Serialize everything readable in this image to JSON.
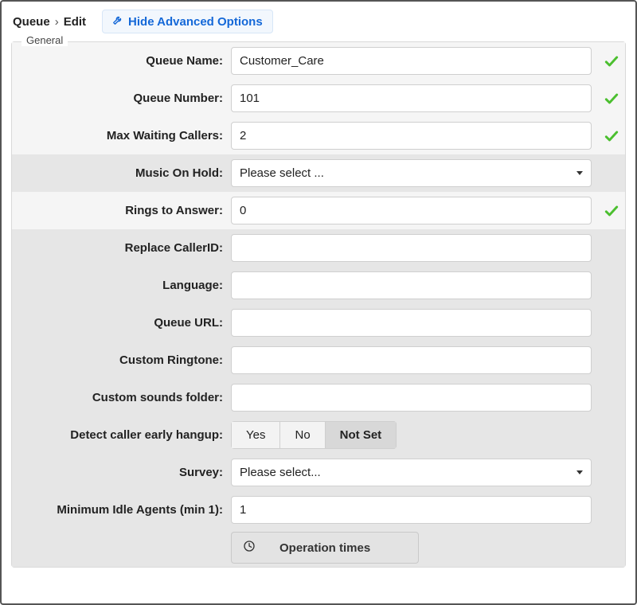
{
  "breadcrumb": {
    "item1": "Queue",
    "item2": "Edit"
  },
  "toggle": {
    "hide_advanced": "Hide Advanced Options"
  },
  "fieldset": {
    "title": "General"
  },
  "labels": {
    "queue_name": "Queue Name:",
    "queue_number": "Queue Number:",
    "max_waiting": "Max Waiting Callers:",
    "music_on_hold": "Music On Hold:",
    "rings_to_answer": "Rings to Answer:",
    "replace_callerid": "Replace CallerID:",
    "language": "Language:",
    "queue_url": "Queue URL:",
    "custom_ringtone": "Custom Ringtone:",
    "custom_sounds_folder": "Custom sounds folder:",
    "detect_hangup": "Detect caller early hangup:",
    "survey": "Survey:",
    "min_idle_agents": "Minimum Idle Agents (min 1):"
  },
  "values": {
    "queue_name": "Customer_Care",
    "queue_number": "101",
    "max_waiting": "2",
    "music_on_hold": "Please select ...",
    "rings_to_answer": "0",
    "replace_callerid": "",
    "language": "",
    "queue_url": "",
    "custom_ringtone": "",
    "custom_sounds_folder": "",
    "survey": "Please select...",
    "min_idle_agents": "1"
  },
  "tristate": {
    "yes": "Yes",
    "no": "No",
    "not_set": "Not Set",
    "selected": "not_set"
  },
  "buttons": {
    "operation_times": "Operation times"
  },
  "colors": {
    "link": "#1468d8",
    "valid_check": "#4bbf2f"
  }
}
